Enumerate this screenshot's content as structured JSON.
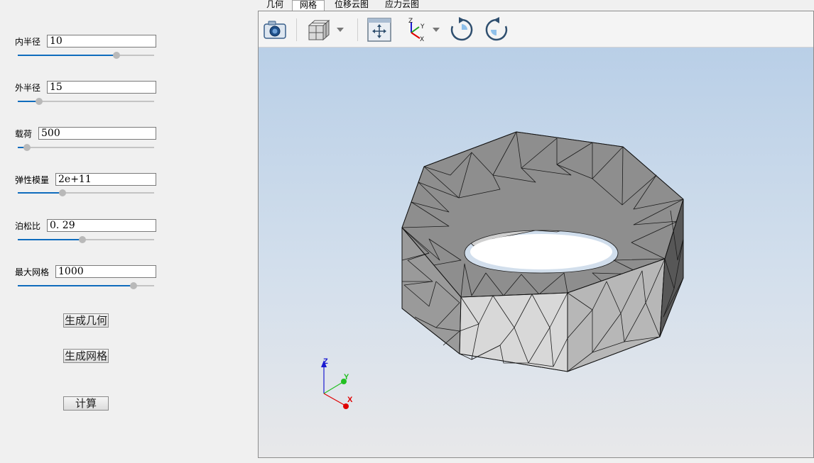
{
  "params": [
    {
      "label": "内半径",
      "value": "10",
      "slider": 0.7
    },
    {
      "label": "外半径",
      "value": "15",
      "slider": 0.15
    },
    {
      "label": "载荷",
      "value": "500",
      "slider": 0.07
    },
    {
      "label": "弹性模量",
      "value": "2e+11",
      "slider": 0.33
    },
    {
      "label": "泊松比",
      "value": "0. 29",
      "slider": 0.46
    },
    {
      "label": "最大网格",
      "value": "1000",
      "slider": 0.85
    }
  ],
  "buttons": {
    "generate_geometry": "生成几何",
    "generate_mesh": "生成网格",
    "compute": "计算"
  },
  "tabs": [
    {
      "label": "几何",
      "active": false
    },
    {
      "label": "网格",
      "active": true
    },
    {
      "label": "位移云图",
      "active": false
    },
    {
      "label": "应力云图",
      "active": false
    }
  ],
  "toolbar": {
    "icons": [
      "camera-icon",
      "view-cube-icon",
      "fit-view-icon",
      "axes-orientation-icon",
      "rotate-clockwise-icon",
      "rotate-counterclockwise-icon"
    ]
  },
  "triad": {
    "x": "X",
    "y": "Y",
    "z": "Z"
  },
  "colors": {
    "accent": "#0f6cbd",
    "axis_x": "#e00000",
    "axis_y": "#22c022",
    "axis_z": "#1a1ad0"
  }
}
